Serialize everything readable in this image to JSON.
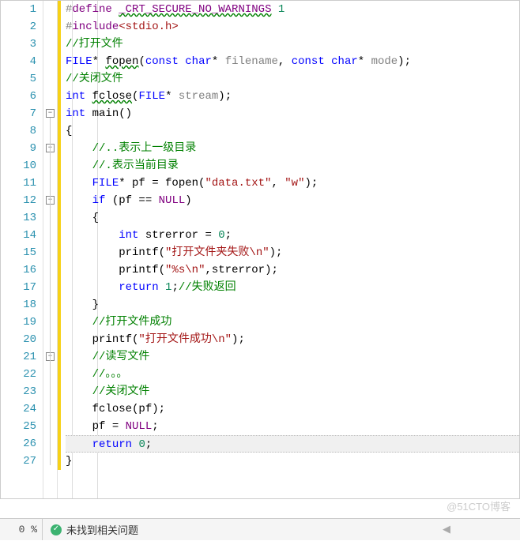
{
  "editor": {
    "lines": [
      {
        "n": 1,
        "tokens": [
          [
            "define",
            "purple"
          ],
          [
            " ",
            ""
          ],
          [
            "_CRT_SECURE_NO_WARNINGS",
            "purple warn"
          ],
          [
            " ",
            ""
          ],
          [
            "1",
            "num"
          ]
        ],
        "prefix": "#"
      },
      {
        "n": 2,
        "tokens": [
          [
            "include",
            "purple"
          ],
          [
            "<stdio.h>",
            "string"
          ]
        ],
        "prefix": "#"
      },
      {
        "n": 3,
        "tokens": [
          [
            "//打开文件",
            "comment"
          ]
        ]
      },
      {
        "n": 4,
        "tokens": [
          [
            "FILE",
            "type"
          ],
          [
            "* ",
            ""
          ],
          [
            "fopen",
            "warn"
          ],
          [
            "(",
            ""
          ],
          [
            "const",
            "kw"
          ],
          [
            " ",
            ""
          ],
          [
            "char",
            "kw"
          ],
          [
            "* ",
            ""
          ],
          [
            "filename",
            "gray"
          ],
          [
            ", ",
            ""
          ],
          [
            "const",
            "kw"
          ],
          [
            " ",
            ""
          ],
          [
            "char",
            "kw"
          ],
          [
            "* ",
            ""
          ],
          [
            "mode",
            "gray"
          ],
          [
            ");",
            ""
          ]
        ]
      },
      {
        "n": 5,
        "tokens": [
          [
            "//关闭文件",
            "comment"
          ]
        ]
      },
      {
        "n": 6,
        "tokens": [
          [
            "int",
            "kw"
          ],
          [
            " ",
            ""
          ],
          [
            "fclose",
            "warn"
          ],
          [
            "(",
            ""
          ],
          [
            "FILE",
            "type"
          ],
          [
            "* ",
            ""
          ],
          [
            "stream",
            "gray"
          ],
          [
            ");",
            ""
          ]
        ]
      },
      {
        "n": 7,
        "tokens": [
          [
            "int",
            "kw"
          ],
          [
            " main()",
            ""
          ]
        ],
        "fold": true,
        "foldType": "minus",
        "indent": -1
      },
      {
        "n": 8,
        "tokens": [
          [
            "{",
            ""
          ]
        ],
        "indent": -1
      },
      {
        "n": 9,
        "tokens": [
          [
            "//..表示上一级目录",
            "comment"
          ]
        ],
        "fold": true,
        "foldType": "minus"
      },
      {
        "n": 10,
        "tokens": [
          [
            "//.表示当前目录",
            "comment"
          ]
        ]
      },
      {
        "n": 11,
        "tokens": [
          [
            "FILE",
            "type"
          ],
          [
            "* pf = fopen(",
            ""
          ],
          [
            "\"data.txt\"",
            "string"
          ],
          [
            ", ",
            ""
          ],
          [
            "\"w\"",
            "string"
          ],
          [
            ");",
            ""
          ]
        ]
      },
      {
        "n": 12,
        "tokens": [
          [
            "if",
            "kw"
          ],
          [
            " (pf == ",
            ""
          ],
          [
            "NULL",
            "purple"
          ],
          [
            ")",
            ""
          ]
        ],
        "fold": true,
        "foldType": "minus"
      },
      {
        "n": 13,
        "tokens": [
          [
            "{",
            ""
          ]
        ]
      },
      {
        "n": 14,
        "tokens": [
          [
            "    ",
            ""
          ],
          [
            "int",
            "kw"
          ],
          [
            " strerror = ",
            ""
          ],
          [
            "0",
            "num"
          ],
          [
            ";",
            ""
          ]
        ]
      },
      {
        "n": 15,
        "tokens": [
          [
            "    printf(",
            ""
          ],
          [
            "\"打开文件夹失败",
            "string"
          ],
          [
            "\\n",
            "esc"
          ],
          [
            "\"",
            "string"
          ],
          [
            ");",
            ""
          ]
        ]
      },
      {
        "n": 16,
        "tokens": [
          [
            "    printf(",
            ""
          ],
          [
            "\"%s",
            "string"
          ],
          [
            "\\n",
            "esc"
          ],
          [
            "\"",
            "string"
          ],
          [
            ",strerror);",
            ""
          ]
        ]
      },
      {
        "n": 17,
        "tokens": [
          [
            "    ",
            ""
          ],
          [
            "return",
            "kw"
          ],
          [
            " ",
            ""
          ],
          [
            "1",
            "num"
          ],
          [
            ";",
            ""
          ],
          [
            "//失败返回",
            "comment"
          ]
        ]
      },
      {
        "n": 18,
        "tokens": [
          [
            "}",
            ""
          ]
        ]
      },
      {
        "n": 19,
        "tokens": [
          [
            "//打开文件成功",
            "comment"
          ]
        ]
      },
      {
        "n": 20,
        "tokens": [
          [
            "printf(",
            ""
          ],
          [
            "\"打开文件成功",
            "string"
          ],
          [
            "\\n",
            "esc"
          ],
          [
            "\"",
            "string"
          ],
          [
            ");",
            ""
          ]
        ]
      },
      {
        "n": 21,
        "tokens": [
          [
            "//读写文件",
            "comment"
          ]
        ],
        "fold": true,
        "foldType": "minus"
      },
      {
        "n": 22,
        "tokens": [
          [
            "//。。。",
            "comment"
          ]
        ]
      },
      {
        "n": 23,
        "tokens": [
          [
            "//关闭文件",
            "comment"
          ]
        ]
      },
      {
        "n": 24,
        "tokens": [
          [
            "fclose(pf);",
            ""
          ]
        ]
      },
      {
        "n": 25,
        "tokens": [
          [
            "pf = ",
            ""
          ],
          [
            "NULL",
            "purple"
          ],
          [
            ";",
            ""
          ]
        ]
      },
      {
        "n": 26,
        "tokens": [
          [
            "return",
            "kw"
          ],
          [
            " ",
            ""
          ],
          [
            "0",
            "num"
          ],
          [
            ";",
            ""
          ]
        ],
        "highlight": true
      },
      {
        "n": 27,
        "tokens": [
          [
            "}",
            ""
          ]
        ],
        "indent": -1
      }
    ],
    "baseIndent": "    "
  },
  "statusbar": {
    "percent": "0 %",
    "message": "未找到相关问题",
    "arrow": "◀"
  },
  "watermark": "@51CTO博客"
}
